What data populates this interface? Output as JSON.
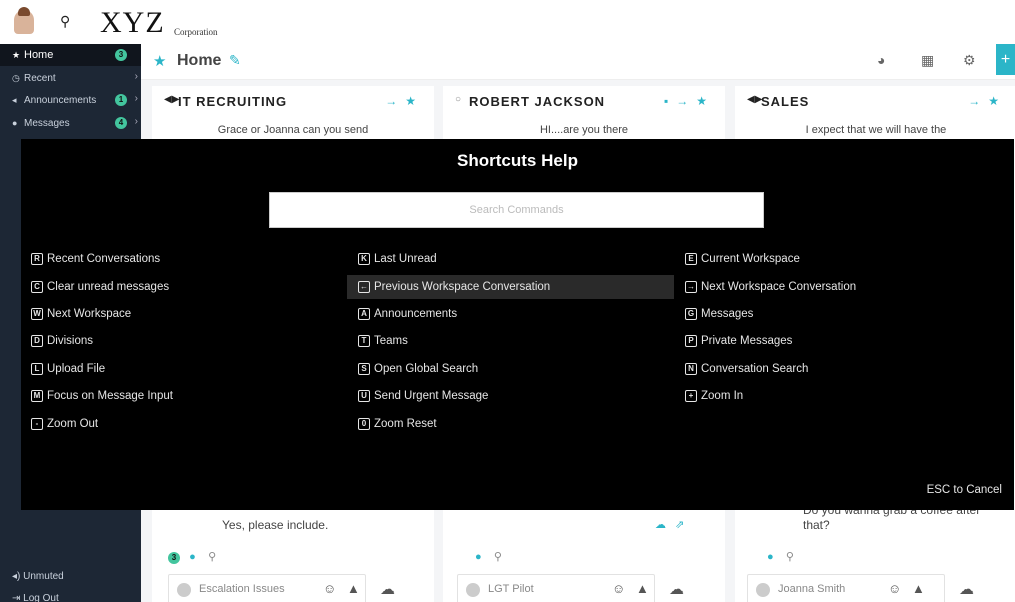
{
  "header": {
    "logo_text": "XYZ",
    "logo_sub": "Corporation",
    "search_icon": "search-icon"
  },
  "sidebar": {
    "items": [
      {
        "label": "Home",
        "icon": "star-icon",
        "badge": "3"
      },
      {
        "label": "Recent",
        "icon": "clock-icon"
      },
      {
        "label": "Announcements",
        "icon": "megaphone-icon",
        "badge": "1"
      },
      {
        "label": "Messages",
        "icon": "chat-icon",
        "badge": "4"
      }
    ],
    "footer": {
      "unmuted": "Unmuted",
      "logout": "Log Out"
    }
  },
  "page": {
    "title": "Home"
  },
  "columns": [
    {
      "title": "IT RECRUITING",
      "preview": "Grace or Joanna can you send",
      "bottom_text": "Yes, please include.",
      "badge": "3",
      "composer_placeholder": "Escalation Issues"
    },
    {
      "title": "ROBERT JACKSON",
      "preview": "HI....are you there",
      "bottom_text": "",
      "composer_placeholder": "LGT Pilot"
    },
    {
      "title": "SALES",
      "preview": "I expect that we will have the",
      "bottom_text_1": "Do you wanna grab a coffee after",
      "bottom_text_2": "that?",
      "composer_placeholder": "Joanna Smith"
    }
  ],
  "shortcuts": {
    "title": "Shortcuts Help",
    "search_placeholder": "Search Commands",
    "esc_label": "ESC to Cancel",
    "col1": [
      {
        "key": "R",
        "label": "Recent Conversations"
      },
      {
        "key": "C",
        "label": "Clear unread messages"
      },
      {
        "key": "W",
        "label": "Next Workspace"
      },
      {
        "key": "D",
        "label": "Divisions"
      },
      {
        "key": "L",
        "label": "Upload File"
      },
      {
        "key": "M",
        "label": "Focus on Message Input"
      },
      {
        "key": "-",
        "label": "Zoom Out"
      }
    ],
    "col2": [
      {
        "key": "K",
        "label": "Last Unread"
      },
      {
        "key": "←",
        "label": "Previous Workspace Conversation"
      },
      {
        "key": "A",
        "label": "Announcements"
      },
      {
        "key": "T",
        "label": "Teams"
      },
      {
        "key": "S",
        "label": "Open Global Search"
      },
      {
        "key": "U",
        "label": "Send Urgent Message"
      },
      {
        "key": "0",
        "label": "Zoom Reset"
      }
    ],
    "col3": [
      {
        "key": "E",
        "label": "Current Workspace"
      },
      {
        "key": "→",
        "label": "Next Workspace Conversation"
      },
      {
        "key": "G",
        "label": "Messages"
      },
      {
        "key": "P",
        "label": "Private Messages"
      },
      {
        "key": "N",
        "label": "Conversation Search"
      },
      {
        "key": "+",
        "label": "Zoom In"
      }
    ]
  },
  "colors": {
    "accent": "#2bb5c8",
    "sidebar_bg": "#1d2735",
    "badge": "#43c59e"
  }
}
